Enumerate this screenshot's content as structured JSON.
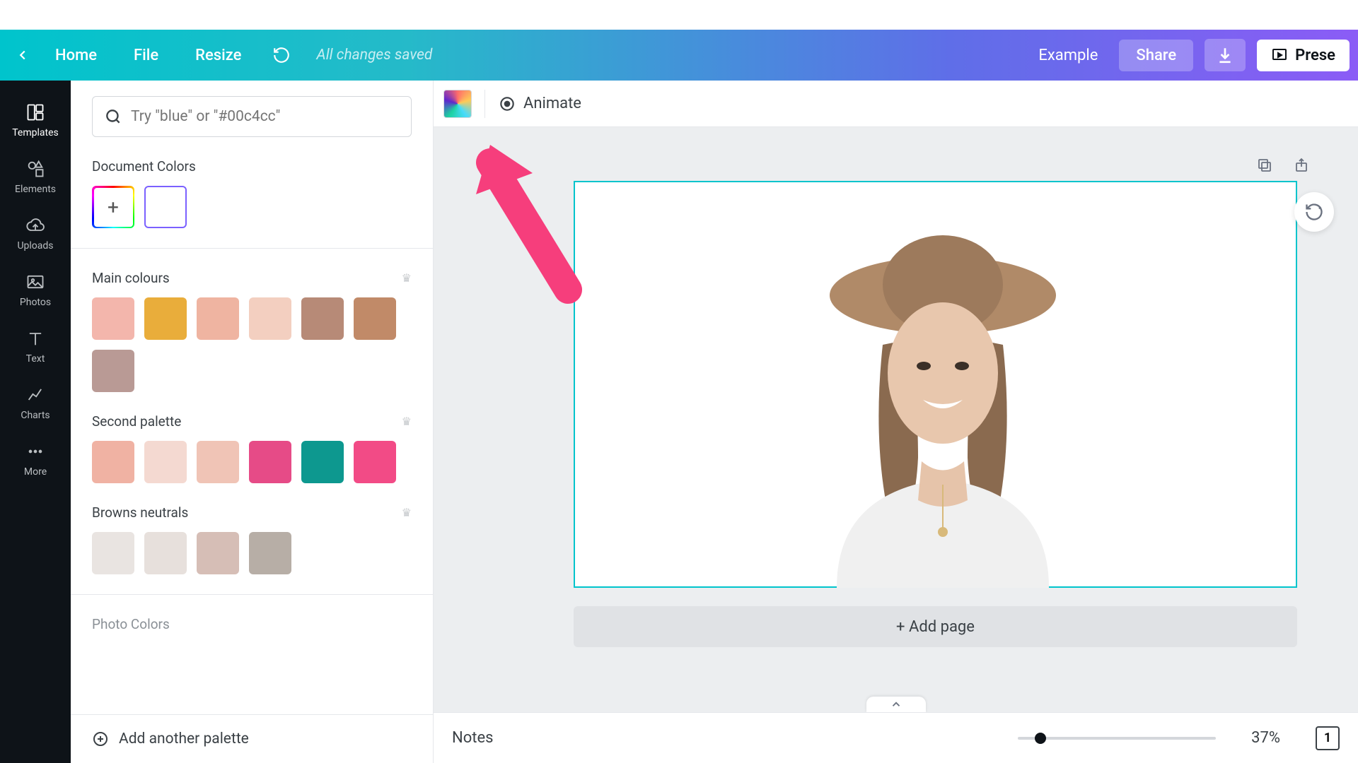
{
  "topbar": {
    "home": "Home",
    "file": "File",
    "resize": "Resize",
    "saved": "All changes saved",
    "title": "Example",
    "share": "Share",
    "present": "Prese"
  },
  "rail": {
    "templates": "Templates",
    "elements": "Elements",
    "uploads": "Uploads",
    "photos": "Photos",
    "text": "Text",
    "charts": "Charts",
    "more": "More"
  },
  "panel": {
    "search_placeholder": "Try \"blue\" or \"#00c4cc\"",
    "doc_colors": "Document Colors",
    "main_colours": "Main colours",
    "second_palette": "Second palette",
    "browns_neutrals": "Browns neutrals",
    "photo_colors": "Photo Colors",
    "add_palette": "Add another palette",
    "colors_main": [
      "#f3b6ac",
      "#e9ad3b",
      "#efb4a1",
      "#f3cfc0",
      "#b78a77",
      "#c18a68",
      "#b99a95"
    ],
    "colors_second": [
      "#f0b2a3",
      "#f4d9d1",
      "#f0c4b6",
      "#e64b87",
      "#0d988f",
      "#f24b86"
    ],
    "colors_browns": [
      "#e9e4e1",
      "#e7e0dc",
      "#d6beb6",
      "#b7aea6"
    ]
  },
  "toolbar": {
    "animate": "Animate"
  },
  "canvas": {
    "add_page": "+ Add page"
  },
  "bottom": {
    "notes": "Notes",
    "zoom": "37%",
    "page": "1"
  }
}
